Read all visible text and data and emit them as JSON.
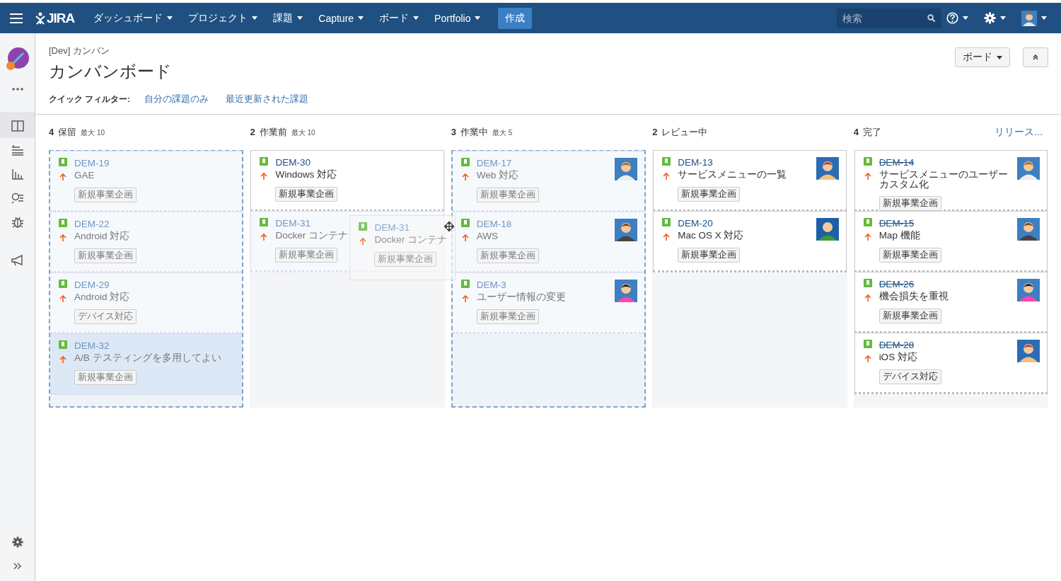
{
  "topbar": {
    "logo": "JIRA",
    "nav": [
      {
        "label": "ダッシュボード"
      },
      {
        "label": "プロジェクト"
      },
      {
        "label": "課題"
      },
      {
        "label": "Capture"
      },
      {
        "label": "ボード"
      },
      {
        "label": "Portfolio"
      }
    ],
    "create": "作成",
    "search": {
      "placeholder": "検索"
    }
  },
  "sidebar": {
    "items": [
      {
        "kind": "project",
        "selected": false
      },
      {
        "kind": "more",
        "selected": false
      },
      {
        "kind": "board",
        "selected": true
      },
      {
        "kind": "backlog",
        "selected": false
      },
      {
        "kind": "reports",
        "selected": false
      },
      {
        "kind": "issues",
        "selected": false
      },
      {
        "kind": "bug",
        "selected": false
      },
      {
        "kind": "announce",
        "selected": false
      }
    ],
    "bottom": [
      {
        "kind": "settings"
      },
      {
        "kind": "expand"
      }
    ]
  },
  "header": {
    "breadcrumb": "[Dev] カンバン",
    "title": "カンバンボード",
    "board_button": "ボード",
    "quick_filter_label": "クイック フィルター:",
    "quick_filters": [
      {
        "label": "自分の課題のみ",
        "selected": false
      },
      {
        "label": "最近更新された課題",
        "selected": false
      }
    ]
  },
  "columns": [
    {
      "count": "4",
      "name": "保留",
      "max": "最大 10",
      "drop_target": true,
      "cards": [
        {
          "key": "DEM-19",
          "summary": "GAE",
          "label": "新規事業企画",
          "done": false,
          "avatar": false,
          "dimmed": true,
          "selected": false
        },
        {
          "key": "DEM-22",
          "summary": "Android 対応",
          "label": "新規事業企画",
          "done": false,
          "avatar": false,
          "dimmed": true,
          "selected": false
        },
        {
          "key": "DEM-29",
          "summary": "Android 対応",
          "label": "デバイス対応",
          "done": false,
          "avatar": false,
          "dimmed": true,
          "selected": false
        },
        {
          "key": "DEM-32",
          "summary": "A/B テスティングを多用してよい",
          "label": "新規事業企画",
          "done": false,
          "avatar": false,
          "dimmed": true,
          "selected": true
        }
      ]
    },
    {
      "count": "2",
      "name": "作業前",
      "max": "最大 10",
      "drop_target": false,
      "cards": [
        {
          "key": "DEM-30",
          "summary": "Windows 対応",
          "label": "新規事業企画",
          "done": false,
          "avatar": false,
          "dimmed": false,
          "selected": false
        },
        {
          "key": "DEM-31",
          "summary": "Docker コンテナ",
          "label": "新規事業企画",
          "done": false,
          "avatar": false,
          "dimmed": true,
          "selected": false
        }
      ],
      "dragging": {
        "key": "DEM-31",
        "summary": "Docker コンテナ",
        "label": "新規事業企画"
      }
    },
    {
      "count": "3",
      "name": "作業中",
      "max": "最大 5",
      "drop_target": true,
      "cards": [
        {
          "key": "DEM-17",
          "summary": "Web 対応",
          "label": "新規事業企画",
          "done": false,
          "avatar": true,
          "dimmed": true,
          "selected": false
        },
        {
          "key": "DEM-18",
          "summary": "AWS",
          "label": "新規事業企画",
          "done": false,
          "avatar": true,
          "dimmed": true,
          "selected": false
        },
        {
          "key": "DEM-3",
          "summary": "ユーザー情報の変更",
          "label": "新規事業企画",
          "done": false,
          "avatar": true,
          "dimmed": true,
          "selected": false
        }
      ]
    },
    {
      "count": "2",
      "name": "レビュー中",
      "drop_target": false,
      "cards": [
        {
          "key": "DEM-13",
          "summary": "サービスメニューの一覧",
          "label": "新規事業企画",
          "done": false,
          "avatar": true,
          "dimmed": false,
          "selected": false
        },
        {
          "key": "DEM-20",
          "summary": "Mac OS X 対応",
          "label": "新規事業企画",
          "done": false,
          "avatar": true,
          "dimmed": false,
          "selected": false
        }
      ]
    },
    {
      "count": "4",
      "name": "完了",
      "link": "リリース...",
      "drop_target": false,
      "cards": [
        {
          "key": "DEM-14",
          "summary": "サービスメニューのユーザーカスタム化",
          "label": "新規事業企画",
          "done": true,
          "avatar": true,
          "dimmed": false,
          "selected": false
        },
        {
          "key": "DEM-15",
          "summary": "Map 機能",
          "label": "新規事業企画",
          "done": true,
          "avatar": true,
          "dimmed": false,
          "selected": false
        },
        {
          "key": "DEM-26",
          "summary": "機会損失を重視",
          "label": "新規事業企画",
          "done": true,
          "avatar": true,
          "dimmed": false,
          "selected": false
        },
        {
          "key": "DEM-28",
          "summary": "iOS 対応",
          "label": "デバイス対応",
          "done": true,
          "avatar": true,
          "dimmed": false,
          "selected": false
        }
      ]
    }
  ]
}
